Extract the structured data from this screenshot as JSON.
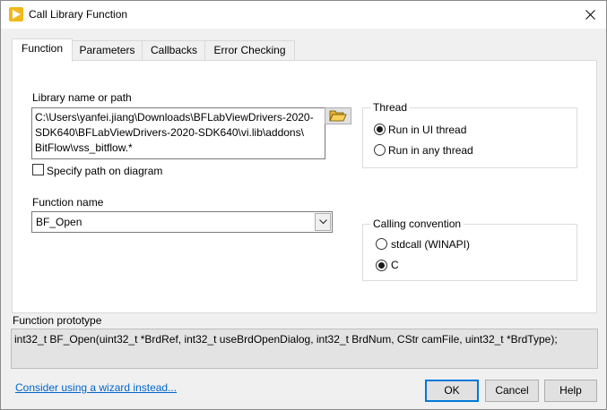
{
  "window": {
    "title": "Call Library Function"
  },
  "tabs": [
    {
      "label": "Function"
    },
    {
      "label": "Parameters"
    },
    {
      "label": "Callbacks"
    },
    {
      "label": "Error Checking"
    }
  ],
  "library": {
    "label": "Library name or path",
    "path_lines": [
      "C:\\Users\\yanfei.jiang\\Downloads\\BFLabViewDrivers-2020-",
      "SDK640\\BFLabViewDrivers-2020-SDK640\\vi.lib\\addons\\",
      "BitFlow\\vss_bitflow.*"
    ],
    "specify_path_label": "Specify path on diagram",
    "specify_path_checked": false
  },
  "function_name": {
    "label": "Function name",
    "value": "BF_Open"
  },
  "thread": {
    "title": "Thread",
    "options": [
      {
        "label": "Run in UI thread",
        "selected": true
      },
      {
        "label": "Run in any thread",
        "selected": false
      }
    ]
  },
  "calling_convention": {
    "title": "Calling convention",
    "options": [
      {
        "label": "stdcall (WINAPI)",
        "selected": false
      },
      {
        "label": "C",
        "selected": true
      }
    ]
  },
  "prototype": {
    "label": "Function prototype",
    "text": "int32_t BF_Open(uint32_t *BrdRef, int32_t useBrdOpenDialog, int32_t BrdNum, CStr camFile, uint32_t *BrdType);"
  },
  "footer": {
    "wizard_link": "Consider using a wizard instead...",
    "ok_label": "OK",
    "cancel_label": "Cancel",
    "help_label": "Help"
  },
  "colors": {
    "link": "#0066cc",
    "default_button_border": "#0078d7",
    "app_icon": "#f0b81c"
  }
}
